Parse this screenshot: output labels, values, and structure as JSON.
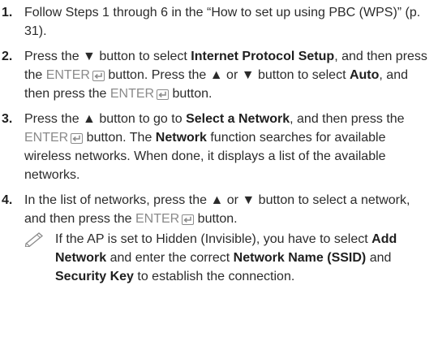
{
  "steps": [
    {
      "num": "1.",
      "parts": [
        {
          "t": "Follow Steps 1 through 6 in the “How to set up using PBC (WPS)” (p. 31)."
        }
      ]
    },
    {
      "num": "2.",
      "parts": [
        {
          "t": "Press the ▼ button to select "
        },
        {
          "t": "Internet Protocol Setup",
          "b": true
        },
        {
          "t": ", and then press the "
        },
        {
          "t": "ENTER",
          "k": true
        },
        {
          "t": " button. Press the ▲ or ▼ button to select "
        },
        {
          "t": "Auto",
          "b": true
        },
        {
          "t": ", and then press the "
        },
        {
          "t": "ENTER",
          "k": true
        },
        {
          "t": " button."
        }
      ]
    },
    {
      "num": "3.",
      "parts": [
        {
          "t": "Press the ▲ button to go to "
        },
        {
          "t": "Select a Network",
          "b": true
        },
        {
          "t": ", and then press the "
        },
        {
          "t": "ENTER",
          "k": true
        },
        {
          "t": " button. The "
        },
        {
          "t": "Network",
          "b": true
        },
        {
          "t": " function searches for available wireless networks. When done, it displays a list of the available networks."
        }
      ]
    },
    {
      "num": "4.",
      "parts": [
        {
          "t": "In the list of networks, press the ▲ or ▼ button to select a network, and then press the "
        },
        {
          "t": "ENTER",
          "k": true
        },
        {
          "t": " button."
        }
      ],
      "note": {
        "icon": "note-pencil-icon",
        "parts": [
          {
            "t": "If the AP is set to Hidden (Invisible), you have to select "
          },
          {
            "t": "Add Network",
            "b": true
          },
          {
            "t": " and enter the correct "
          },
          {
            "t": "Network Name (SSID)",
            "b": true
          },
          {
            "t": " and "
          },
          {
            "t": "Security Key",
            "b": true
          },
          {
            "t": " to establish the connection."
          }
        ]
      }
    }
  ],
  "colors": {
    "text": "#2b2b2b",
    "key": "#8a8a8a"
  }
}
